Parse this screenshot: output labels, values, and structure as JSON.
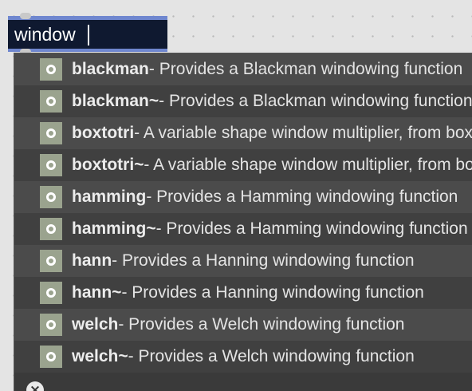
{
  "search": {
    "value": "window"
  },
  "results": [
    {
      "name": "blackman",
      "desc": " - Provides a Blackman windowing function"
    },
    {
      "name": "blackman~",
      "desc": " - Provides a Blackman windowing function"
    },
    {
      "name": "boxtotri",
      "desc": " - A variable shape window multiplier, from box to triangle"
    },
    {
      "name": "boxtotri~",
      "desc": " - A variable shape window multiplier, from box to triangle"
    },
    {
      "name": "hamming",
      "desc": " - Provides a Hamming windowing function"
    },
    {
      "name": "hamming~",
      "desc": " - Provides a Hamming windowing function"
    },
    {
      "name": "hann",
      "desc": " - Provides a Hanning windowing function"
    },
    {
      "name": "hann~",
      "desc": " - Provides a Hanning windowing function"
    },
    {
      "name": "welch",
      "desc": " - Provides a Welch windowing function"
    },
    {
      "name": "welch~",
      "desc": " - Provides a Welch windowing function"
    }
  ],
  "icons": {
    "result_icon": "object-icon",
    "close": "close-icon"
  },
  "colors": {
    "canvas": "#e4e4e4",
    "patch_box_border": "#6f87cf",
    "patch_box_fill": "#0f1930",
    "dropdown_row_a": "#4b4b4b",
    "dropdown_row_b": "#404040",
    "icon": "#9aa38e"
  },
  "close_glyph": "×"
}
